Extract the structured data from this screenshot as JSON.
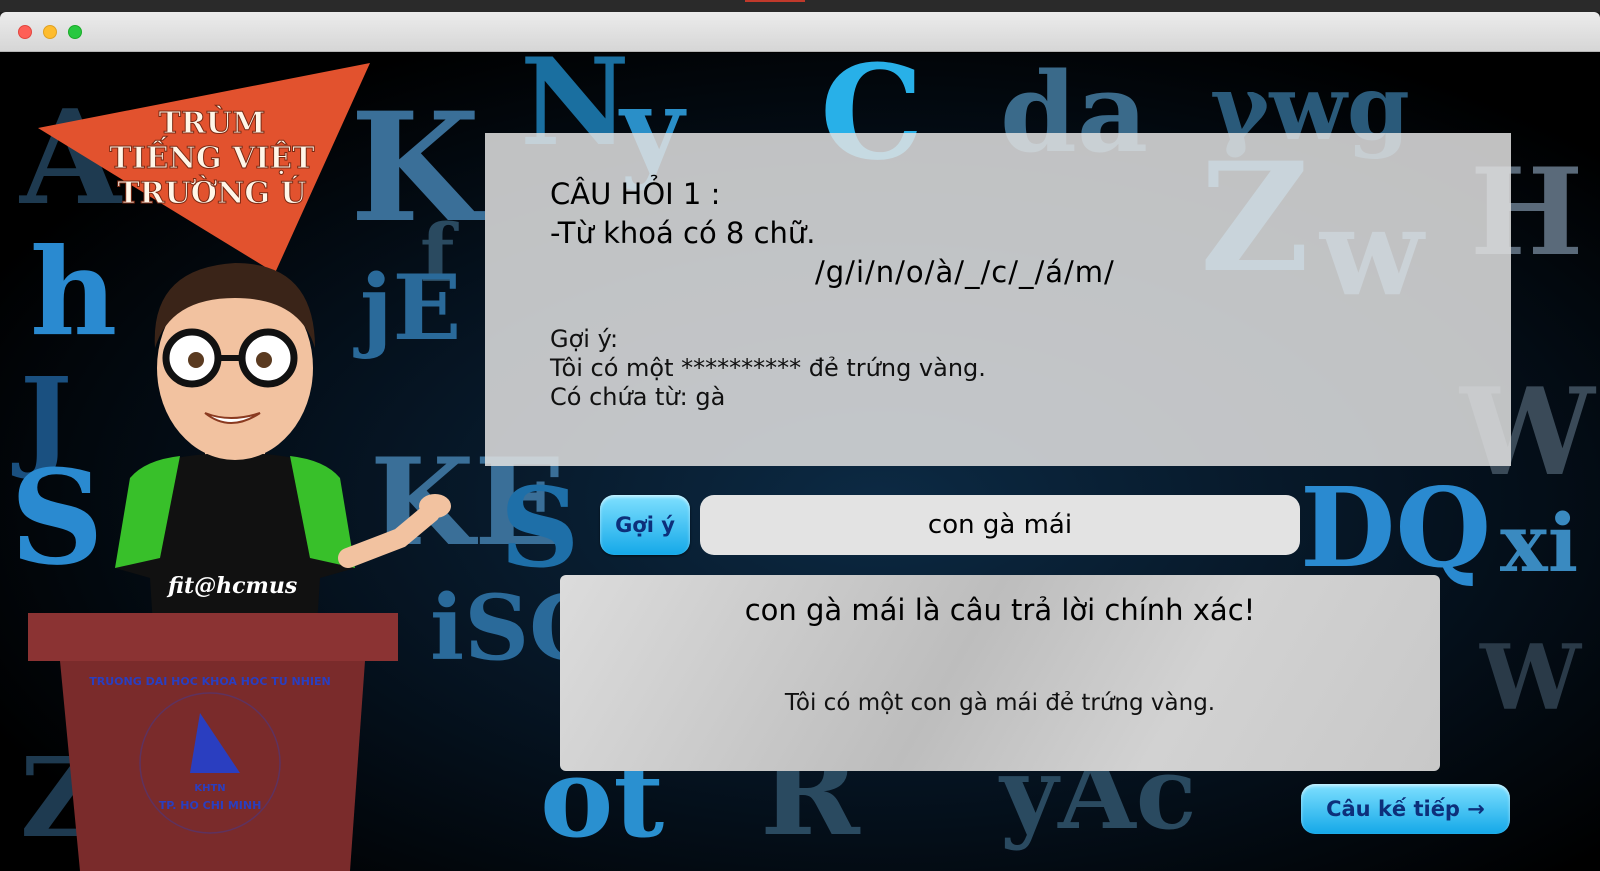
{
  "logo": {
    "line1": "TRÙM",
    "line2": "TIẾNG VIỆT",
    "line3": "TRƯỜNG Ú"
  },
  "mascot": {
    "shirt_text": "fit@hcmus"
  },
  "podium": {
    "seal_top": "TRUONG DAI HOC KHOA HOC TU NHIEN",
    "seal_center": "KHTN",
    "seal_bottom": "TP. HO CHI MINH"
  },
  "question": {
    "title": "CÂU HỎI 1 :",
    "keyword_info": "-Từ khoá có 8 chữ.",
    "puzzle": "/g/i/n/o/à/_/c/_/á/m/",
    "hint_label": "Gợi ý:",
    "hint_sentence": "Tôi có một ********** đẻ trứng vàng.",
    "hint_contains": "Có chứa từ: gà"
  },
  "controls": {
    "hint_button": "Gợi ý",
    "answer_value": "con gà mái",
    "next_button": "Câu kế tiếp →"
  },
  "result": {
    "message": "con gà mái là câu trả lời chính xác!",
    "full_sentence": "Tôi có một con gà mái đẻ trứng vàng."
  },
  "colors": {
    "logo_orange": "#e2522e",
    "button_blue": "#14a8e8",
    "shirt_green": "#38c02a",
    "podium": "#7a2b2b"
  }
}
